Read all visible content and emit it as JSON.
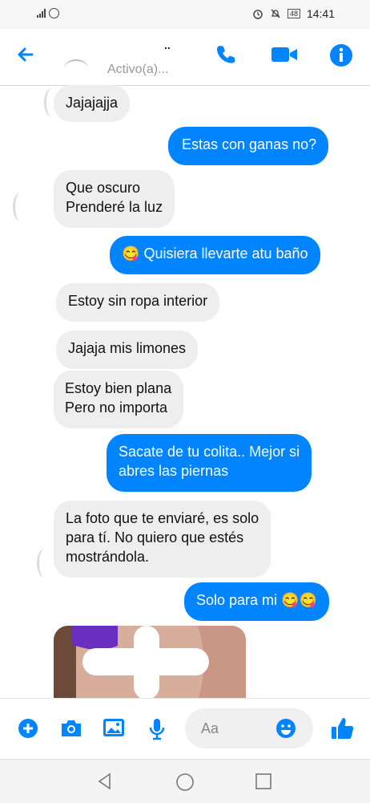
{
  "status_bar": {
    "time": "14:41",
    "battery": "48"
  },
  "header": {
    "contact_name": "..",
    "contact_status": "Activo(a)..."
  },
  "messages": [
    {
      "side": "in",
      "text": "Jajajajja"
    },
    {
      "side": "out",
      "text": "Estas con ganas no?"
    },
    {
      "side": "in",
      "text": "Que oscuro\nPrenderé la luz"
    },
    {
      "side": "out",
      "emoji": "😋",
      "text": "Quisiera llevarte atu baño"
    },
    {
      "side": "in",
      "text": "Estoy sin ropa interior"
    },
    {
      "side": "in",
      "text": "Jajaja mis limones"
    },
    {
      "side": "in",
      "text": "Estoy bien plana\nPero no importa"
    },
    {
      "side": "out",
      "text": "Sacate de tu colita.. Mejor si\nabres las piernas"
    },
    {
      "side": "in",
      "text": "La foto que te enviaré, es solo\npara tí. No quiero que estés\nmostrándola."
    },
    {
      "side": "out",
      "text": "Solo para mi 😋😋"
    }
  ],
  "composer": {
    "placeholder": "Aa"
  },
  "icons": {
    "back": "arrow-left-icon",
    "call": "phone-icon",
    "video": "video-camera-icon",
    "info": "info-icon",
    "add": "plus-circle-icon",
    "camera": "camera-icon",
    "gallery": "image-icon",
    "mic": "microphone-icon",
    "emoji": "smiley-icon",
    "like": "thumbs-up-icon"
  },
  "colors": {
    "accent": "#0084ff",
    "incoming_bubble": "#eeeeee",
    "outgoing_bubble": "#0084ff"
  }
}
